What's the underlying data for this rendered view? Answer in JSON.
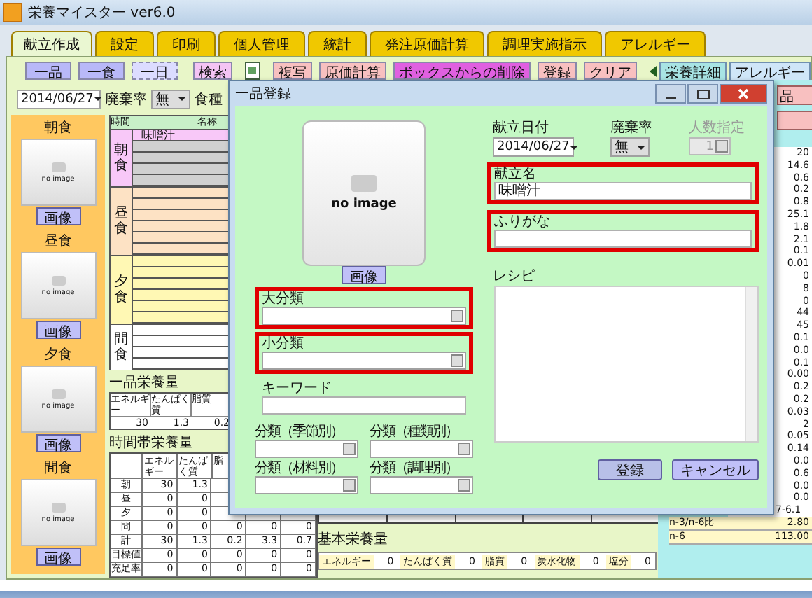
{
  "window": {
    "title": "栄養マイスター ver6.0"
  },
  "tabs": [
    {
      "label": "献立作成",
      "selected": true
    },
    {
      "label": "設定",
      "selected": false
    },
    {
      "label": "印刷",
      "selected": false
    },
    {
      "label": "個人管理",
      "selected": false
    },
    {
      "label": "統計",
      "selected": false
    },
    {
      "label": "発注原価計算",
      "selected": false
    },
    {
      "label": "調理実施指示",
      "selected": false
    },
    {
      "label": "アレルギー",
      "selected": false
    }
  ],
  "toolbar": [
    {
      "label": "一品",
      "kind": "view"
    },
    {
      "label": "一食",
      "kind": "view"
    },
    {
      "label": "一日",
      "kind": "view-light"
    },
    {
      "label": "検索",
      "kind": "pink"
    },
    {
      "kind": "icon"
    },
    {
      "label": "複写",
      "kind": "salmon"
    },
    {
      "label": "原価計算",
      "kind": "salmon"
    },
    {
      "label": "ボックスからの削除",
      "kind": "magenta"
    },
    {
      "label": "登録",
      "kind": "salmon"
    },
    {
      "label": "クリア",
      "kind": "salmon"
    }
  ],
  "side_tabs": [
    {
      "label": "栄養詳細",
      "selected": true
    },
    {
      "label": "アレルギー",
      "selected": false
    }
  ],
  "filters": {
    "date": "2014/06/27",
    "waste_label": "廃棄率",
    "waste_value": "無",
    "meal_type_label": "食種"
  },
  "meal_panels": [
    {
      "label": "朝食",
      "image_text": "no image",
      "button": "画像"
    },
    {
      "label": "昼食",
      "image_text": "no image",
      "button": "画像"
    },
    {
      "label": "夕食",
      "image_text": "no image",
      "button": "画像"
    },
    {
      "label": "間食",
      "image_text": "no image",
      "button": "画像"
    }
  ],
  "menu_grid": {
    "time_header": "時間",
    "name_header": "名称",
    "groups": [
      {
        "label": "朝食",
        "color": "#f8c8f8",
        "items": [
          "味噌汁"
        ]
      },
      {
        "label": "昼食",
        "color": "#fde2c4"
      },
      {
        "label": "夕食",
        "color": "#fff8b4"
      },
      {
        "label": "間食",
        "color": "#ffffff"
      }
    ]
  },
  "item_nutrition": {
    "title": "一品栄養量",
    "headers": [
      "エネルギー",
      "たんぱく質",
      "脂質"
    ],
    "values": [
      "30",
      "1.3",
      "0.2"
    ]
  },
  "time_nutrition": {
    "title": "時間帯栄養量",
    "headers": [
      "エネルギー",
      "たんぱく質",
      "脂"
    ],
    "rows": [
      {
        "label": "朝",
        "values": [
          "30",
          "1.3"
        ]
      },
      {
        "label": "昼",
        "values": [
          "0",
          "0"
        ]
      },
      {
        "label": "夕",
        "values": [
          "0",
          "0"
        ]
      },
      {
        "label": "間",
        "values": [
          "0",
          "0",
          "0",
          "0",
          "0"
        ]
      },
      {
        "label": "計",
        "values": [
          "30",
          "1.3",
          "0.2",
          "3.3",
          "0.7"
        ]
      },
      {
        "label": "目標値",
        "values": [
          "0",
          "0",
          "0",
          "0",
          "0"
        ]
      },
      {
        "label": "充足率",
        "values": [
          "0",
          "0",
          "0",
          "0",
          "0"
        ]
      }
    ]
  },
  "basic_nutrition": {
    "title": "基本栄養量",
    "items": [
      {
        "label": "エネルギー",
        "value": "0"
      },
      {
        "label": "たんぱく質",
        "value": "0"
      },
      {
        "label": "脂質",
        "value": "0"
      },
      {
        "label": "炭水化物",
        "value": "0"
      },
      {
        "label": "塩分",
        "value": "0"
      }
    ]
  },
  "detail_panel": {
    "button": "品",
    "values": [
      "20",
      "14.6",
      "0.6",
      "0.2",
      "0.8",
      "25.1",
      "1.8",
      "2.1",
      "0.1",
      "0.01",
      "0",
      "8",
      "0",
      "44",
      "45",
      "0.1",
      "0.0",
      "0.1",
      "0.00",
      "0.2",
      "0.2",
      "0.03",
      "2",
      "0.05",
      "0.14",
      "0.0",
      "0.6",
      "0.0",
      "0.0"
    ],
    "note": "7-6.1",
    "ratio_rows": [
      {
        "label": "n-3/n-6比",
        "value": "2.80"
      },
      {
        "label": "n-6",
        "value": "113.00"
      }
    ]
  },
  "dialog": {
    "title": "一品登録",
    "image_text": "no image",
    "image_button": "画像",
    "left_fields": [
      {
        "label": "大分類",
        "kind": "select",
        "highlighted": true
      },
      {
        "label": "小分類",
        "kind": "select",
        "highlighted": true
      },
      {
        "label": "キーワード",
        "kind": "text",
        "highlighted": false
      }
    ],
    "categories": [
      "分類（季節別）",
      "分類（種類別）",
      "分類（材料別）",
      "分類（調理別）"
    ],
    "date": {
      "label": "献立日付",
      "value": "2014/06/27"
    },
    "waste": {
      "label": "廃棄率",
      "value": "無"
    },
    "servings": {
      "label": "人数指定",
      "value": "1",
      "disabled": true
    },
    "name_field": {
      "label": "献立名",
      "value": "味噌汁",
      "highlighted": true
    },
    "furigana_field": {
      "label": "ふりがな",
      "highlighted": true
    },
    "recipe": {
      "label": "レシピ"
    },
    "buttons": [
      {
        "label": "登録",
        "kind": "primary"
      },
      {
        "label": "キャンセル",
        "kind": "default"
      }
    ]
  }
}
